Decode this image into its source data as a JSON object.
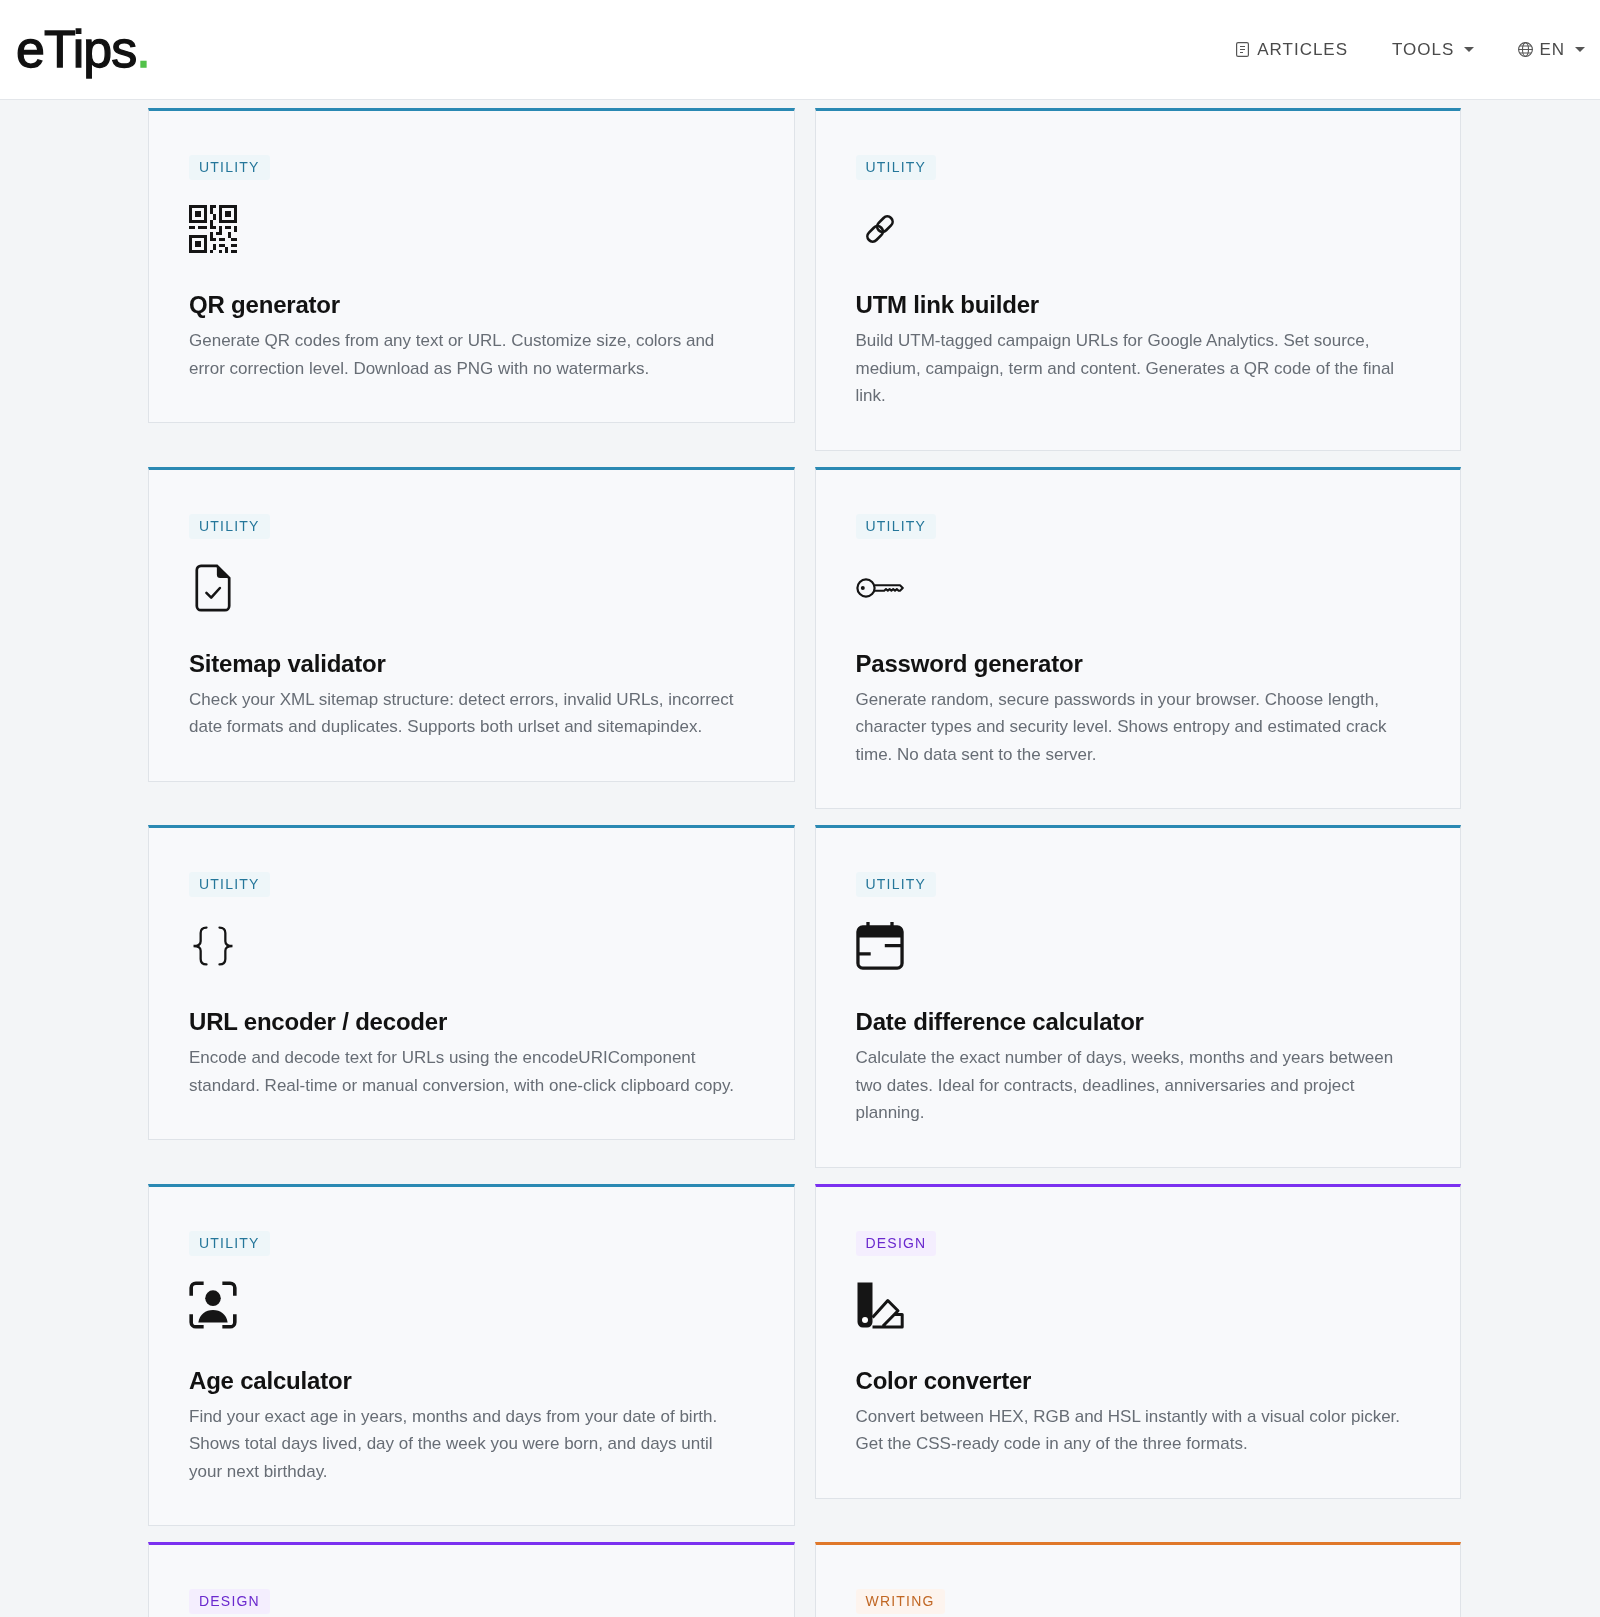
{
  "header": {
    "logo": {
      "text": "eTips",
      "accent": "."
    },
    "nav": [
      {
        "label": "ARTICLES",
        "kind": "link"
      },
      {
        "label": "TOOLS",
        "kind": "dropdown"
      },
      {
        "label": "EN",
        "kind": "language"
      }
    ]
  },
  "cards": [
    {
      "tag": "UTILITY",
      "color": "#2a89b3",
      "title": "QR generator",
      "description": "Generate QR codes from any text or URL. Customize size, colors and error correction level. Download as PNG with no watermarks."
    },
    {
      "tag": "UTILITY",
      "color": "#2a89b3",
      "title": "UTM link builder",
      "description": "Build UTM-tagged campaign URLs for Google Analytics. Set source, medium, campaign, term and content. Generates a QR code of the final link."
    },
    {
      "tag": "UTILITY",
      "color": "#2a89b3",
      "title": "Sitemap validator",
      "description": "Check your XML sitemap structure: detect errors, invalid URLs, incorrect date formats and duplicates. Supports both urlset and sitemapindex."
    },
    {
      "tag": "UTILITY",
      "color": "#2a89b3",
      "title": "Password generator",
      "description": "Generate random, secure passwords in your browser. Choose length, character types and security level. Shows entropy and estimated crack time. No data sent to the server."
    },
    {
      "tag": "UTILITY",
      "color": "#2a89b3",
      "title": "URL encoder / decoder",
      "description": "Encode and decode text for URLs using the encodeURIComponent standard. Real-time or manual conversion, with one-click clipboard copy."
    },
    {
      "tag": "UTILITY",
      "color": "#2a89b3",
      "title": "Date difference calculator",
      "description": "Calculate the exact number of days, weeks, months and years between two dates. Ideal for contracts, deadlines, anniversaries and project planning."
    },
    {
      "tag": "UTILITY",
      "color": "#2a89b3",
      "title": "Age calculator",
      "description": "Find your exact age in years, months and days from your date of birth. Shows total days lived, day of the week you were born, and days until your next birthday."
    },
    {
      "tag": "DESIGN",
      "color": "#7b30f0",
      "title": "Color converter",
      "description": "Convert between HEX, RGB and HSL instantly with a visual color picker. Get the CSS-ready code in any of the three formats."
    },
    {
      "tag": "DESIGN",
      "color": "#7b30f0"
    },
    {
      "tag": "WRITING",
      "color": "#e0782a"
    }
  ]
}
